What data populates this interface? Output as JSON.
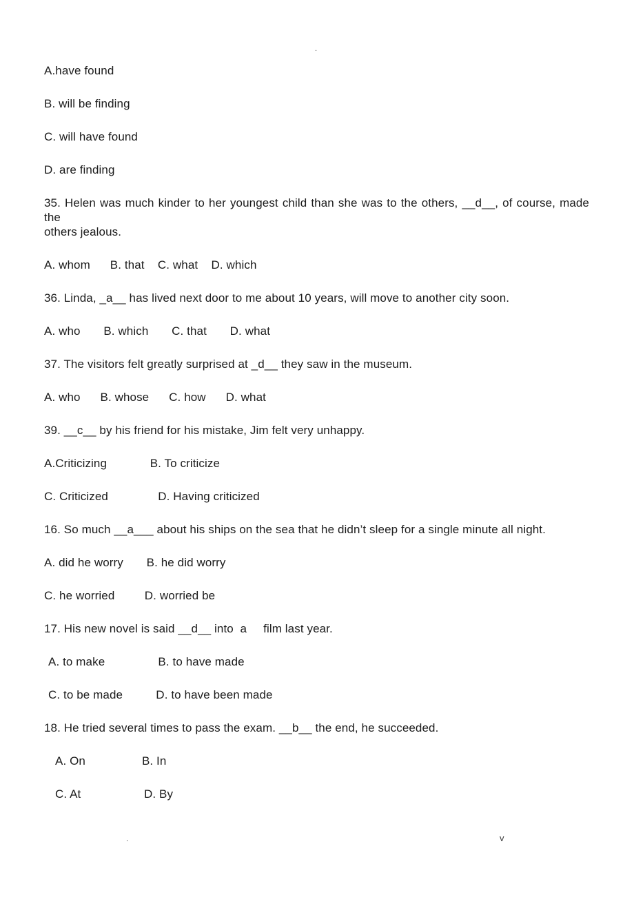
{
  "page": {
    "stray_marks": {
      "top_center": ".",
      "bottom_left": ".",
      "bottom_right": "v"
    }
  },
  "document": {
    "orphan_options": [
      "A.have found",
      "B. will be finding",
      "C. will have found",
      "D. are finding"
    ],
    "questions": [
      {
        "number": "35",
        "stem_line_1": "35. Helen was much kinder to her youngest child than she was to the others, __d__, of course, made the",
        "stem_line_2": "others jealous.",
        "option_rows": [
          "A. whom      B. that    C. what    D. which"
        ]
      },
      {
        "number": "36",
        "stem_line_1": "36. Linda, _a__ has lived next door to me about 10 years, will move to another city soon.",
        "option_rows": [
          "A. who       B. which       C. that       D. what"
        ]
      },
      {
        "number": "37",
        "stem_line_1": "37. The visitors felt greatly surprised at _d__ they saw in the museum.",
        "option_rows": [
          "A. who      B. whose      C. how      D. what"
        ]
      },
      {
        "number": "39",
        "stem_line_1": "39. __c__ by his friend for his mistake, Jim felt very unhappy.",
        "option_rows": [
          "A.Criticizing             B. To criticize",
          "C. Criticized               D. Having criticized"
        ]
      },
      {
        "number": "16",
        "stem_line_1": "16. So much __a___ about his ships on the sea that he didn’t sleep for a single minute all night.",
        "option_rows": [
          "A. did he worry       B. he did worry",
          "C. he worried         D. worried be"
        ]
      },
      {
        "number": "17",
        "stem_line_1": "17. His new novel is said __d__ into  a     film last year.",
        "option_rows": [
          "A. to make                B. to have made",
          "C. to be made          D. to have been made"
        ]
      },
      {
        "number": "18",
        "stem_line_1": "18. He tried several times to pass the exam. __b__ the end, he succeeded.",
        "option_rows": [
          "A. On                 B. In",
          "C. At                   D. By"
        ]
      }
    ]
  }
}
